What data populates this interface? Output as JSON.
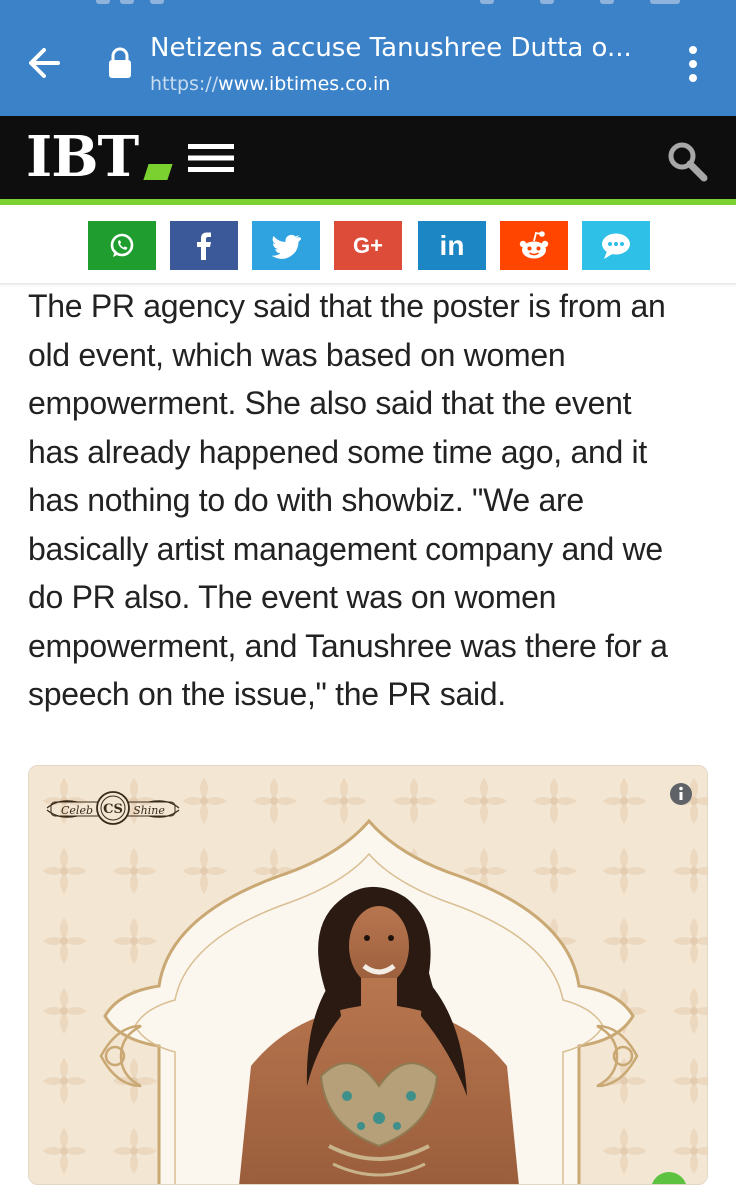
{
  "browser": {
    "title": "Netizens accuse Tanushree Dutta o...",
    "url_scheme": "https://",
    "url_host": "www.ibtimes.co.in",
    "bar_color": "#3b82c9"
  },
  "site": {
    "logo": "IBT",
    "accent_color": "#7bd12f"
  },
  "share": [
    {
      "name": "whatsapp",
      "color": "#1f9d2f"
    },
    {
      "name": "facebook",
      "color": "#3b5998"
    },
    {
      "name": "twitter",
      "color": "#2ea3e0"
    },
    {
      "name": "google-plus",
      "label": "G+",
      "color": "#dd4b39"
    },
    {
      "name": "linkedin",
      "label": "in",
      "color": "#1b86c3"
    },
    {
      "name": "reddit",
      "color": "#ff4500"
    },
    {
      "name": "sms",
      "color": "#2ec0e6"
    }
  ],
  "article": {
    "lines": [
      "The PR agency said that the poster is from an",
      "old event, which was based on women",
      "empowerment. She also said that the event",
      "has already happened some time ago, and it",
      "has nothing to do with showbiz. \"We are",
      "basically artist management company and we",
      "do PR also. The event was on women",
      "empowerment, and Tanushree was there for a",
      "speech on the issue,\" the PR said."
    ]
  },
  "poster": {
    "logo_left": "Celeb",
    "logo_mono": "CS",
    "logo_right": "Shine"
  }
}
